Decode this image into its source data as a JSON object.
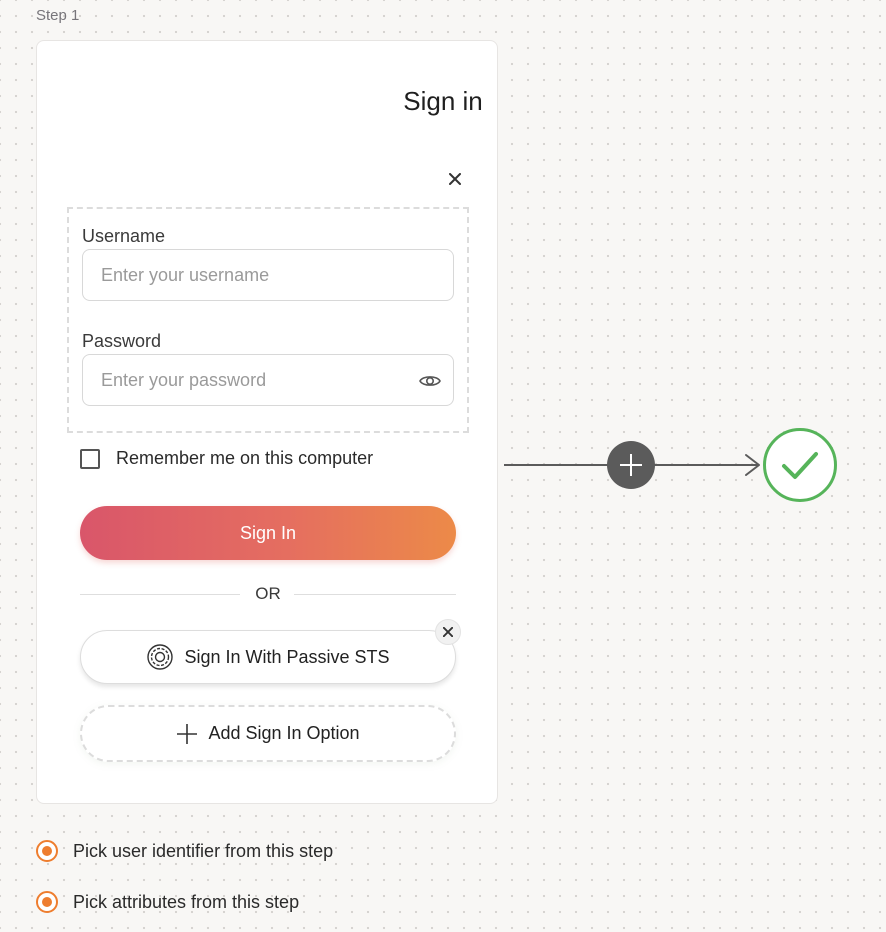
{
  "step": {
    "label": "Step 1"
  },
  "card": {
    "title": "Sign in",
    "username": {
      "label": "Username",
      "placeholder": "Enter your username",
      "value": ""
    },
    "password": {
      "label": "Password",
      "placeholder": "Enter your password",
      "value": ""
    },
    "remember": {
      "label": "Remember me on this computer",
      "checked": false
    },
    "sign_in_button": "Sign In",
    "or_text": "OR",
    "passive_sts_button": "Sign In With Passive STS",
    "add_option": "Add Sign In Option"
  },
  "options": [
    {
      "label": "Pick user identifier from this step",
      "selected": true
    },
    {
      "label": "Pick attributes from this step",
      "selected": true
    }
  ],
  "colors": {
    "accent_orange": "#ee7d2e",
    "success_green": "#56b45a",
    "gradient_start": "#d9566a",
    "gradient_end": "#ec8a48",
    "connector_gray": "#5b5b5b"
  },
  "icons": {
    "close": "close-icon",
    "eye": "eye-icon",
    "passive_sts": "gear-icon",
    "add": "plus-icon",
    "success": "check-icon"
  }
}
